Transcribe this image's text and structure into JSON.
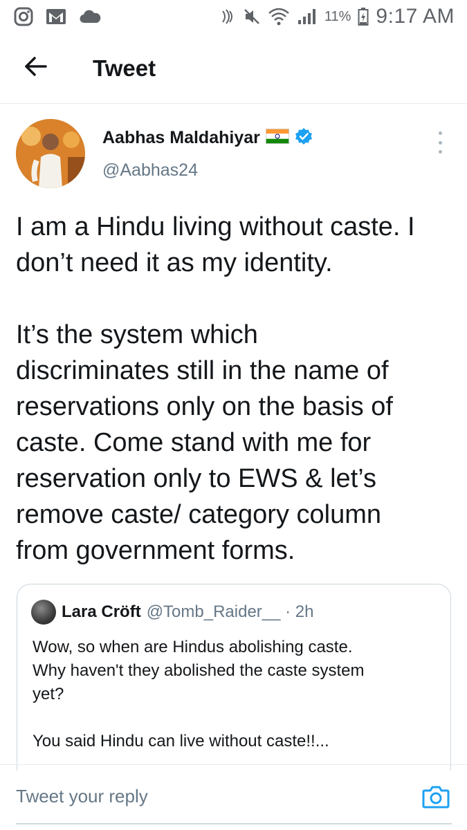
{
  "status_bar": {
    "icons_left": [
      "instagram-icon",
      "gmail-icon",
      "cloud-icon"
    ],
    "icons_right": [
      "nfc-icon",
      "mute-icon",
      "wifi-icon",
      "signal-icon",
      "battery-icon"
    ],
    "battery": "11%",
    "time": "9:17 AM"
  },
  "header": {
    "back_icon": "arrow-left-icon",
    "title": "Tweet"
  },
  "tweet": {
    "author_name": "Aabhas Maldahiyar",
    "author_handle": "@Aabhas24",
    "flag_icon": "india-flag-icon",
    "verified_icon": "verified-badge-icon",
    "more_icon": "more-vertical-icon",
    "text_line_1": "I am a Hindu living without caste. I",
    "text_line_2": "don’t need it as my identity.",
    "text_line_3": "It’s the system which",
    "text_line_4": "discriminates still in the name of",
    "text_line_5": "reservations only on the basis of",
    "text_line_6": "caste. Come stand with me for",
    "text_line_7": "reservation only to EWS & let’s",
    "text_line_8": "remove caste/ category column",
    "text_line_9": "from government forms."
  },
  "quote": {
    "author_name": "Lara Cröft",
    "author_handle": "@Tomb_Raider__ · 2h",
    "text_line_1": "Wow, so when are Hindus abolishing caste.",
    "text_line_2": "Why haven't they abolished the caste system",
    "text_line_3": "yet?",
    "text_line_4": "You said Hindu can live without caste!!..."
  },
  "reply": {
    "placeholder": "Tweet your reply",
    "camera_icon": "camera-icon"
  },
  "colors": {
    "accent": "#1da1f2",
    "text_primary": "#14171a",
    "text_secondary": "#657786",
    "border": "#e6ecf0"
  }
}
